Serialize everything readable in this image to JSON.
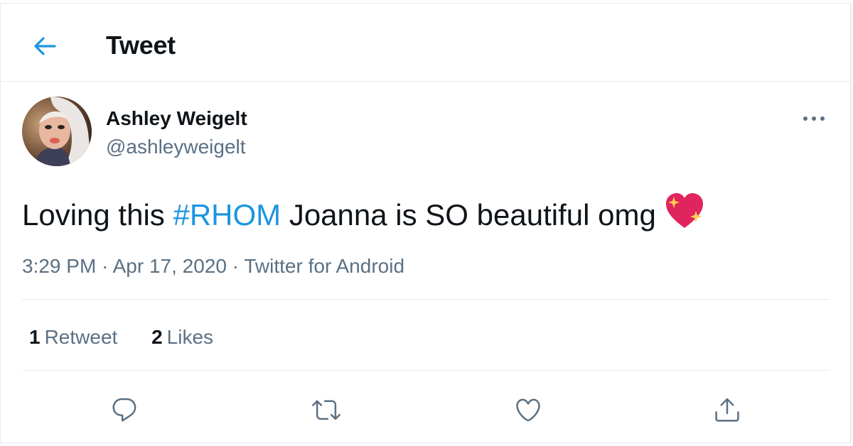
{
  "header": {
    "title": "Tweet",
    "back_icon": "arrow-left-icon"
  },
  "author": {
    "display_name": "Ashley Weigelt",
    "handle": "@ashleyweigelt",
    "avatar_icon": "user-avatar"
  },
  "more_icon": "more-horizontal-icon",
  "tweet": {
    "text_before": "Loving this ",
    "hashtag": "#RHOM",
    "text_after": " Joanna is SO beautiful omg",
    "emoji_icon": "sparkling-heart-emoji"
  },
  "meta": {
    "time": "3:29 PM",
    "separator": "·",
    "date": "Apr 17, 2020",
    "source": "Twitter for Android"
  },
  "stats": {
    "retweets_count": "1",
    "retweets_label": "Retweet",
    "likes_count": "2",
    "likes_label": "Likes"
  },
  "actions": [
    "reply-icon",
    "retweet-icon",
    "like-icon",
    "share-icon"
  ],
  "colors": {
    "accent": "#1b95e0",
    "text": "#0f1419",
    "secondary": "#5b7083",
    "divider": "#e6ecf0",
    "emoji_red": "#e0245e"
  }
}
